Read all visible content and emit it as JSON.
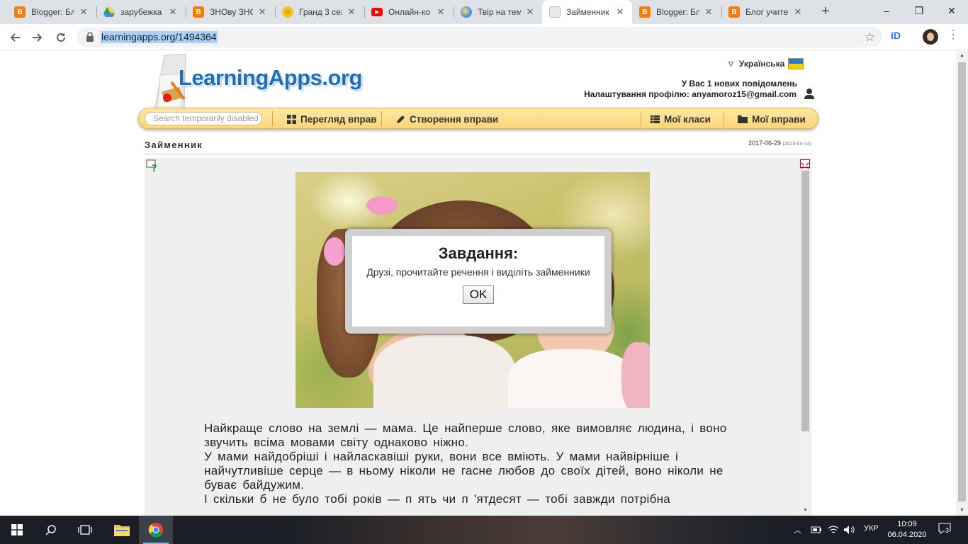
{
  "browser": {
    "tabs": [
      {
        "title": "Blogger: Бл",
        "favicon": "blogger-icon",
        "color": "#f57d00"
      },
      {
        "title": "зарубежка",
        "favicon": "drive-icon",
        "color": "#1fa463"
      },
      {
        "title": "ЗНОву ЗНО",
        "favicon": "blogger-icon",
        "color": "#f57d00"
      },
      {
        "title": "Гранд 3 сез",
        "favicon": "emoji-icon",
        "color": "#f5c518"
      },
      {
        "title": "Онлайн-ко",
        "favicon": "youtube-icon",
        "color": "#ff0000"
      },
      {
        "title": "Твір на тем",
        "favicon": "globe-icon",
        "color": "#4a90d9"
      },
      {
        "title": "Займенник",
        "favicon": "learningapps-icon",
        "color": "#cccccc"
      },
      {
        "title": "Blogger: Бл",
        "favicon": "blogger-icon",
        "color": "#f57d00"
      },
      {
        "title": "Блог учите",
        "favicon": "blogger-icon",
        "color": "#f57d00"
      }
    ],
    "active_tab": 6,
    "url": "learningapps.org/1494364"
  },
  "header": {
    "logo": "LearningApps.org",
    "language": "Українська",
    "messages_prefix": "У Вас ",
    "messages_count": "1",
    "messages_suffix": " нових повідомлень",
    "profile_label": "Налаштування профілю: ",
    "profile_email": "anyamoroz15@gmail.com"
  },
  "menu": {
    "search_placeholder": "Search temporarily disabled",
    "browse": "Перегляд вправ",
    "create": "Створення вправи",
    "classes": "Мої класи",
    "apps": "Мої вправи"
  },
  "app": {
    "title": "Займенник",
    "date": "2017-06-29",
    "date_small": "(2015-04-14)",
    "dialog": {
      "title": "Завдання:",
      "body": "Друзі, прочитайте речення і виділіть займенники",
      "ok": "OK"
    },
    "paragraphs": [
      "Найкраще слово на землі — мама. Це найперше слово, яке вимовляє людина, і воно звучить всіма мовами світу однаково ніжно.",
      "У мами найдобріші і найласкавіші руки, вони все вміють. У мами найвірніше і найчутливіше серце — в ньому ніколи не гасне любов до своїх дітей, воно ніколи не буває байдужим.",
      "І скільки б не було тобі років — п ять чи п 'ятдесят — тобі завжди потрібна"
    ]
  },
  "taskbar": {
    "lang": "УКР",
    "time": "10:09",
    "date": "06.04.2020",
    "notifications": "3"
  }
}
